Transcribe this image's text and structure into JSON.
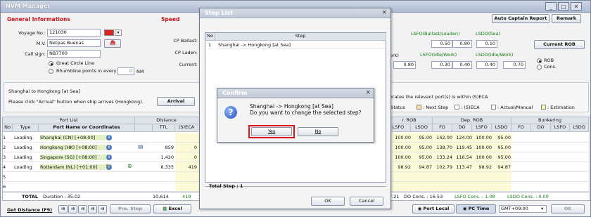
{
  "window": {
    "title": "NVM Manager"
  },
  "toolbar": {
    "auto_captain": "Auto Captain Report",
    "remark": "Remark",
    "current_rob": "Current ROB",
    "rob": "ROB",
    "cons": "Cons."
  },
  "general": {
    "heading": "General Informations",
    "voyage_label": "Voyage No.:",
    "voyage": "121030",
    "mv_label": "M.V.",
    "mv": "Netpas Buenas",
    "callsign_label": "Call sign:",
    "callsign": "NB7700",
    "gc": "Great Circle Line",
    "rl": "Rhumbline points in every",
    "rl_val": "0",
    "nm": "NM"
  },
  "speed": {
    "heading": "Speed",
    "cp_ballast": "CP Ballast:",
    "cp_laden": "CP Laden:",
    "current": "Current:"
  },
  "fuel": {
    "lsfo_bl": "LSFO(Ballast/Loaden)",
    "lsdo_sea": "LSDO(Sea)",
    "lsfo_il": "LSFO(Idle/Work)",
    "lsdo_il": "LSDO(Idle/Work)",
    "v1": "0.50",
    "v2": "0.80",
    "v3": "0.10",
    "v4": "0.80",
    "v5": "0.30",
    "v6": "0.40",
    "v7": "0.40",
    "v8": "0.70",
    "work": "ork)"
  },
  "route": {
    "line": "Shanghai to Hongkong [at Sea]",
    "hint": "Please click \"Arrival\" button when ship arrives (Hongkong).",
    "arrival": "Arrival",
    "eca_note": "ndicates the relevant port(s) is within (S)ECA",
    "status": "r. Status",
    "next": ": Next Step",
    "seca": ": (S)ECA",
    "actual": ": Actual/Manual",
    "estimation": ": Estimation"
  },
  "grid": {
    "port_list": "Port List",
    "distance": "Distance",
    "no": "No",
    "type": "Type",
    "port": "Port Name or Coordinates",
    "ttl": "TTL",
    "seca": "(S)ECA",
    "rob": "r. ROB",
    "dep_rob": "Dep. ROB",
    "bunkering": "Bunkering",
    "lsfo": "LSFO",
    "lsdo": "LSDO",
    "fo": "FO",
    "do": "DO",
    "rows": [
      {
        "no": "1",
        "type": "Loading",
        "port": "Shanghai (CN) [+08:00]",
        "ttl": "",
        "seca": "",
        "c1": "100.00",
        "c2": "95.00",
        "c3": "142.00",
        "c4": "124.00",
        "c5": "100.00",
        "c6": "95.00"
      },
      {
        "no": "2",
        "type": "Loading",
        "port": "Hongkong (HK) [+08:00]",
        "ttl": "859",
        "seca": "0",
        "c1": "100.00",
        "c2": "95.00",
        "c3": "138.70",
        "c4": "119.45",
        "c5": "100.00",
        "c6": "95.00"
      },
      {
        "no": "3",
        "type": "Loading",
        "port": "Singapore (SG) [+08:00]",
        "ttl": "1,420",
        "seca": "0",
        "c1": "100.00",
        "c2": "95.00",
        "c3": "133.24",
        "c4": "116.54",
        "c5": "100.00",
        "c6": "95.00"
      },
      {
        "no": "4",
        "type": "Loading",
        "port": "Rotterdam (NL) [+01:00]",
        "ttl": "8,335",
        "seca": "419",
        "c1": "98.92",
        "c2": "94.87",
        "c3": "102.79",
        "c4": "113.47",
        "c5": "98.92",
        "c6": "94.87"
      },
      {
        "no": "5",
        "type": "",
        "port": "",
        "ttl": "",
        "seca": "",
        "c1": "",
        "c2": "",
        "c3": "",
        "c4": "",
        "c5": "",
        "c6": ""
      },
      {
        "no": "6",
        "type": "",
        "port": "",
        "ttl": "",
        "seca": "",
        "c1": "",
        "c2": "",
        "c3": "",
        "c4": "",
        "c5": "",
        "c6": ""
      }
    ],
    "total_label": "TOTAL",
    "duration": "Duration : 35.02",
    "total_ttl": "10,614",
    "total_seca": "419",
    "do_cons_pre": "97.21",
    "do_cons": "DO Cons. : 16.53",
    "lsfo_cons": "LSFO Cons. : 1.08",
    "lsdo_cons": "LSDO Cons. : 0.00"
  },
  "footer": {
    "get_distance": "Get Distance (F9)",
    "pre_step": "Pre. Step",
    "excel": "Excel",
    "port_local": "Port Local",
    "pc_time": "PC Time",
    "gmt": "GMT+09:00",
    "ok": "OK"
  },
  "step_list": {
    "title": "Step List",
    "col_no": "No",
    "col_step": "Step",
    "row_no": "1",
    "row_step": "Shanghai -> Hongkong [at Sea]",
    "total": "Total Step : 1",
    "ok": "OK",
    "cancel": "Cancel"
  },
  "confirm": {
    "title": "Confirm",
    "line1": "Shanghai -> Hongkong [at Sea]",
    "line2": "Do you want to change the selected step?",
    "yes": "Yes",
    "no": "No"
  }
}
